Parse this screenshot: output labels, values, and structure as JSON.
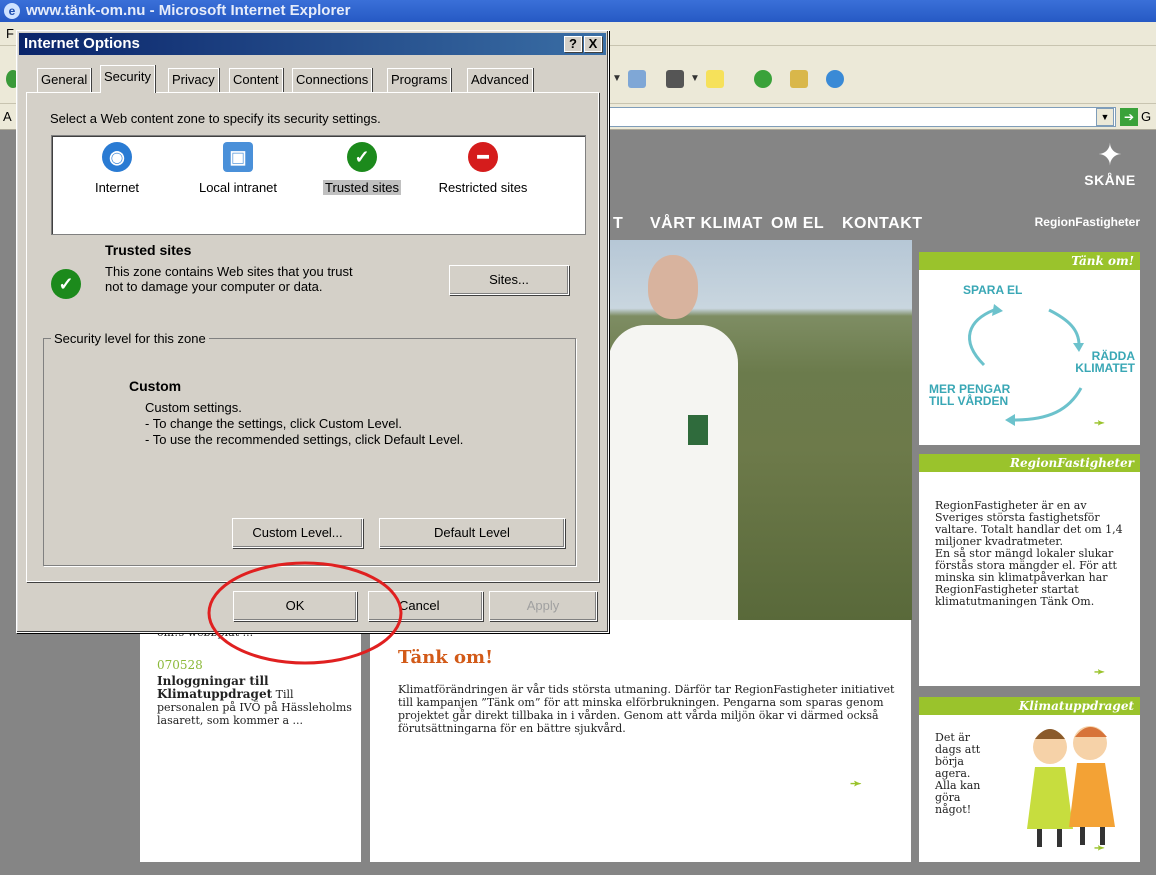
{
  "browser": {
    "title": "www.tänk-om.nu - Microsoft Internet Explorer",
    "menu_fragment": "F",
    "address_label": "A",
    "go_label": "G"
  },
  "site": {
    "logo_text": "SKÅNE",
    "nav": [
      "T",
      "VÅRT KLIMAT",
      "OM EL",
      "KONTAKT"
    ],
    "brand": "RegionFastigheter",
    "side_cards": [
      {
        "heading": "Tänk om!",
        "cycle": [
          "SPARA EL",
          "RÄDDA KLIMATET",
          "MER PENGAR TILL VÅRDEN"
        ]
      },
      {
        "heading": "RegionFastigheter",
        "text": "RegionFastigheter är en av Sveriges största fastighetsför valtare. Totalt handlar det om 1,4 miljoner kvadratmeter.\n   En så stor mängd lokaler slukar förstås stora mängder el. För att minska sin klimatpåverkan har RegionFastigheter startat klimatutmaningen Tänk Om."
      },
      {
        "heading": "Klimatuppdraget",
        "text": "Det är dags att börja agera. Alla kan göra något!"
      }
    ],
    "main": {
      "title": "Tänk om!",
      "text": "Klimatförändringen är vår tids största utmaning. Därför tar RegionFastigheter initiativet till kampanjen ”Tänk om” för att minska elförbrukningen. Pengarna som sparas genom projektet går direkt tillbaka in i vården. Genom att vårda miljön ökar vi därmed också förutsättningarna för en bättre sjukvård."
    },
    "news": {
      "snippet": "om!s webbplat ...",
      "date": "070528",
      "title": "Inloggningar till Klimatuppdraget",
      "text": "Till personalen på IVÖ på Hässleholms lasarett, som kommer a ..."
    },
    "arrow": "➛"
  },
  "dialog": {
    "title": "Internet Options",
    "help_btn": "?",
    "close_btn": "X",
    "tabs": [
      "General",
      "Security",
      "Privacy",
      "Content",
      "Connections",
      "Programs",
      "Advanced"
    ],
    "active_tab": "Security",
    "zone_prompt": "Select a Web content zone to specify its security settings.",
    "zones": [
      {
        "label": "Internet",
        "color": "#2a7bd3"
      },
      {
        "label": "Local intranet",
        "color": "#4a90d9"
      },
      {
        "label": "Trusted sites",
        "color": "#1c8a1c"
      },
      {
        "label": "Restricted sites",
        "color": "#d51c1c"
      }
    ],
    "selected_zone": {
      "name": "Trusted sites",
      "description": "This zone contains Web sites that you trust not to damage your computer or data."
    },
    "sites_btn": "Sites...",
    "security_level_label": "Security level for this zone",
    "level_name": "Custom",
    "level_desc": [
      "Custom settings.",
      "- To change the settings, click Custom Level.",
      "- To use the recommended settings, click Default Level."
    ],
    "custom_level_btn": "Custom Level...",
    "default_level_btn": "Default Level",
    "ok_btn": "OK",
    "cancel_btn": "Cancel",
    "apply_btn": "Apply"
  },
  "colors": {
    "accent_green": "#9ac32c",
    "highlight_circle": "#e02020",
    "title_orange": "#d25a18"
  }
}
